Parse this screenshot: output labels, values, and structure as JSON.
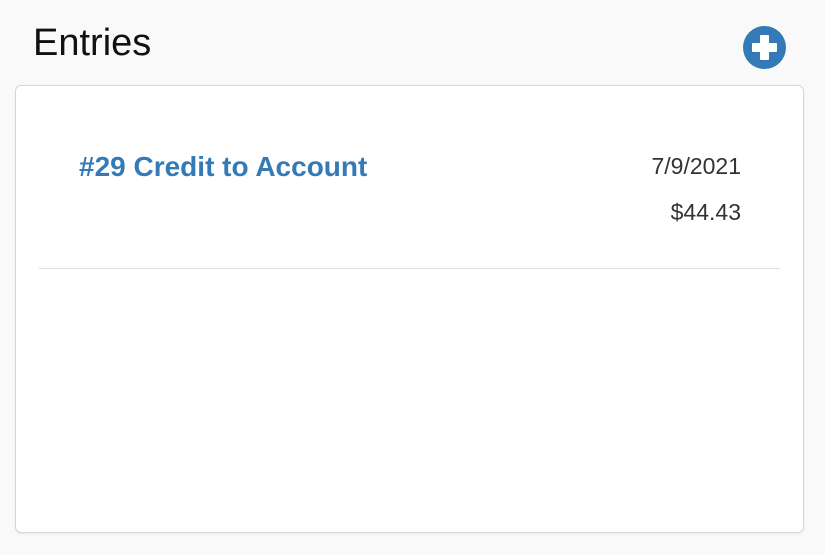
{
  "header": {
    "title": "Entries",
    "add_icon": "plus-circle-icon",
    "accent_color": "#337ab7"
  },
  "entries": [
    {
      "title": "#29 Credit to Account",
      "date": "7/9/2021",
      "amount": "$44.43"
    }
  ]
}
